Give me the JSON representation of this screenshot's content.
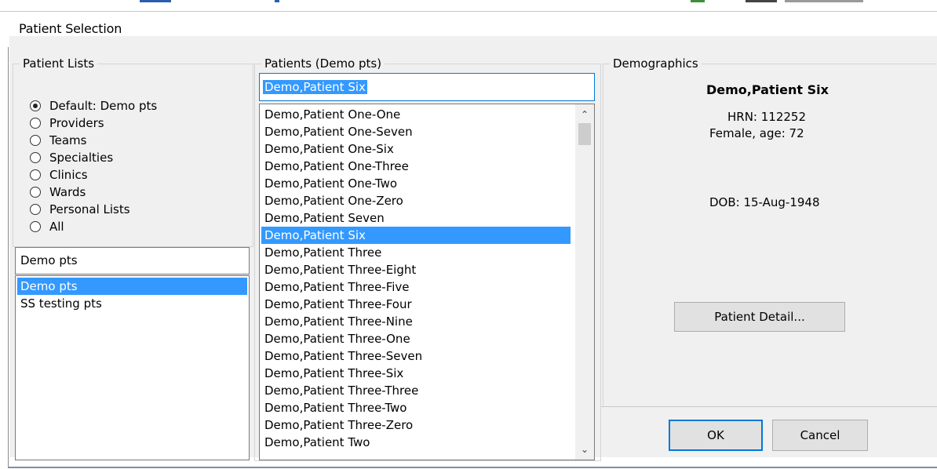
{
  "window": {
    "title": "Patient Selection"
  },
  "patient_lists": {
    "group_title": "Patient Lists",
    "radios": [
      {
        "label": "Default: Demo pts",
        "selected": true
      },
      {
        "label": "Providers",
        "selected": false
      },
      {
        "label": "Teams",
        "selected": false
      },
      {
        "label": "Specialties",
        "selected": false
      },
      {
        "label": "Clinics",
        "selected": false
      },
      {
        "label": "Wards",
        "selected": false
      },
      {
        "label": "Personal Lists",
        "selected": false
      },
      {
        "label": "All",
        "selected": false
      }
    ],
    "filter_value": "Demo pts",
    "items": [
      {
        "label": "Demo pts",
        "selected": true
      },
      {
        "label": "SS testing pts",
        "selected": false
      }
    ]
  },
  "patients": {
    "group_title": "Patients (Demo pts)",
    "search_value": "Demo,Patient Six",
    "items": [
      {
        "label": "Demo,Patient One-One",
        "selected": false
      },
      {
        "label": "Demo,Patient One-Seven",
        "selected": false
      },
      {
        "label": "Demo,Patient One-Six",
        "selected": false
      },
      {
        "label": "Demo,Patient One-Three",
        "selected": false
      },
      {
        "label": "Demo,Patient One-Two",
        "selected": false
      },
      {
        "label": "Demo,Patient One-Zero",
        "selected": false
      },
      {
        "label": "Demo,Patient Seven",
        "selected": false
      },
      {
        "label": "Demo,Patient Six",
        "selected": true
      },
      {
        "label": "Demo,Patient Three",
        "selected": false
      },
      {
        "label": "Demo,Patient Three-Eight",
        "selected": false
      },
      {
        "label": "Demo,Patient Three-Five",
        "selected": false
      },
      {
        "label": "Demo,Patient Three-Four",
        "selected": false
      },
      {
        "label": "Demo,Patient Three-Nine",
        "selected": false
      },
      {
        "label": "Demo,Patient Three-One",
        "selected": false
      },
      {
        "label": "Demo,Patient Three-Seven",
        "selected": false
      },
      {
        "label": "Demo,Patient Three-Six",
        "selected": false
      },
      {
        "label": "Demo,Patient Three-Three",
        "selected": false
      },
      {
        "label": "Demo,Patient Three-Two",
        "selected": false
      },
      {
        "label": "Demo,Patient Three-Zero",
        "selected": false
      },
      {
        "label": "Demo,Patient Two",
        "selected": false
      }
    ],
    "scroll_up_icon": "chevron-up-icon",
    "scroll_down_icon": "chevron-down-icon"
  },
  "demographics": {
    "group_title": "Demographics",
    "name": "Demo,Patient Six",
    "hrn": "HRN: 112252",
    "sex_age": "Female, age: 72",
    "dob": "DOB: 15-Aug-1948",
    "detail_button": "Patient Detail..."
  },
  "buttons": {
    "ok": "OK",
    "cancel": "Cancel"
  },
  "colors": {
    "selection": "#3399ff",
    "dialog_bg": "#f0f0f0",
    "default_button_border": "#0078d7"
  }
}
